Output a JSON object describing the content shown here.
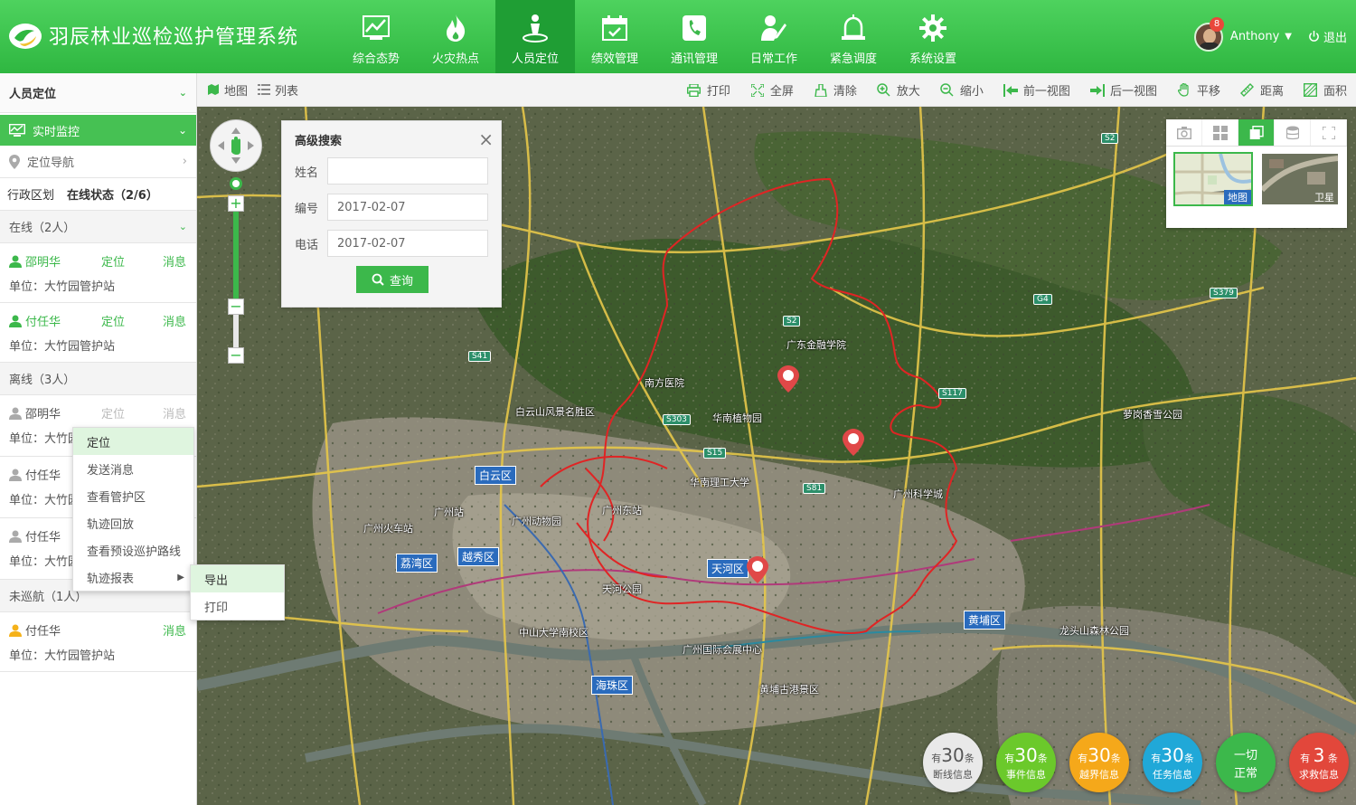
{
  "app": {
    "title": "羽辰林业巡检巡护管理系统"
  },
  "nav": [
    {
      "label": "综合态势",
      "icon": "chart-icon"
    },
    {
      "label": "火灾热点",
      "icon": "fire-icon"
    },
    {
      "label": "人员定位",
      "icon": "person-location-icon"
    },
    {
      "label": "绩效管理",
      "icon": "calendar-check-icon"
    },
    {
      "label": "通讯管理",
      "icon": "phone-icon"
    },
    {
      "label": "日常工作",
      "icon": "person-pen-icon"
    },
    {
      "label": "紧急调度",
      "icon": "alarm-icon"
    },
    {
      "label": "系统设置",
      "icon": "gear-icon"
    }
  ],
  "user": {
    "name": "Anthony",
    "badge": "8",
    "logout": "退出"
  },
  "toolbar": {
    "left": [
      {
        "label": "地图",
        "icon": "map-icon"
      },
      {
        "label": "列表",
        "icon": "list-icon"
      }
    ],
    "right": [
      {
        "label": "打印",
        "icon": "printer-icon"
      },
      {
        "label": "全屏",
        "icon": "fullscreen-icon"
      },
      {
        "label": "清除",
        "icon": "clear-icon"
      },
      {
        "label": "放大",
        "icon": "zoom-in-icon"
      },
      {
        "label": "缩小",
        "icon": "zoom-out-icon"
      },
      {
        "label": "前一视图",
        "icon": "prev-view-icon"
      },
      {
        "label": "后一视图",
        "icon": "next-view-icon"
      },
      {
        "label": "平移",
        "icon": "pan-icon"
      },
      {
        "label": "距离",
        "icon": "ruler-icon"
      },
      {
        "label": "面积",
        "icon": "area-icon"
      }
    ]
  },
  "sidebar": {
    "header": "人员定位",
    "monitor": "实时监控",
    "navigation": "定位导航",
    "tabs": [
      "行政区划",
      "在线状态（2/6）"
    ],
    "online": {
      "title": "在线（2人）",
      "people": [
        {
          "name": "邵明华",
          "loc": "定位",
          "msg": "消息",
          "unit": "单位：大竹园管护站"
        },
        {
          "name": "付任华",
          "loc": "定位",
          "msg": "消息",
          "unit": "单位：大竹园管护站"
        }
      ]
    },
    "offline": {
      "title": "离线（3人）",
      "people": [
        {
          "name": "邵明华",
          "loc": "定位",
          "msg": "消息",
          "unit": "单位：大竹园管护站"
        },
        {
          "name": "付任华",
          "unit": "单位：大竹园管护站"
        },
        {
          "name": "付任华",
          "unit": "单位：大竹园管护站"
        }
      ]
    },
    "unpatrolled": {
      "title": "未巡航（1人）",
      "people": [
        {
          "name": "付任华",
          "msg": "消息",
          "unit": "单位：大竹园管护站"
        }
      ]
    }
  },
  "context_menu": {
    "items": [
      "定位",
      "发送消息",
      "查看管护区",
      "轨迹回放",
      "查看预设巡护路线",
      "轨迹报表"
    ],
    "submenu": [
      "导出",
      "打印"
    ]
  },
  "advanced_search": {
    "title": "高级搜索",
    "name_label": "姓名",
    "name_value": "",
    "id_label": "编号",
    "id_value": "2017-02-07",
    "phone_label": "电话",
    "phone_value": "2017-02-07",
    "submit": "查询"
  },
  "layer_switcher": {
    "map_label": "地图",
    "satellite_label": "卫星"
  },
  "map": {
    "districts": [
      "白云区",
      "荔湾区",
      "越秀区",
      "天河区",
      "黄埔区",
      "海珠区"
    ],
    "places": [
      "广州站",
      "广州东站",
      "广州火车站",
      "广东金融学院",
      "华南植物园",
      "华南理工大学",
      "广州动物园",
      "中山大学南校区",
      "天河公园",
      "广州国际会展中心",
      "龙头山森林公园",
      "黄埔古港景区",
      "白云山风景名胜区",
      "广州科学城",
      "萝岗香雪公园",
      "南方医院"
    ]
  },
  "stats": [
    {
      "prefix": "有",
      "num": "30",
      "unit": "条",
      "desc": "断线信息",
      "color": "#e9e9e9"
    },
    {
      "prefix": "有",
      "num": "30",
      "unit": "条",
      "desc": "事件信息",
      "color": "#6bc92b"
    },
    {
      "prefix": "有",
      "num": "30",
      "unit": "条",
      "desc": "越界信息",
      "color": "#f5a81a"
    },
    {
      "prefix": "有",
      "num": "30",
      "unit": "条",
      "desc": "任务信息",
      "color": "#20a8d8"
    },
    {
      "prefix": "",
      "num": "一切",
      "unit": "",
      "desc": "正常",
      "color": "#3cb84b"
    },
    {
      "prefix": "有",
      "num": "3",
      "unit": "条",
      "desc": "求救信息",
      "color": "#e2473b"
    }
  ]
}
